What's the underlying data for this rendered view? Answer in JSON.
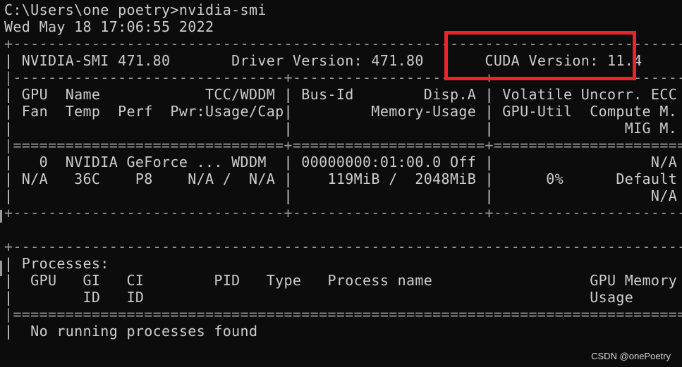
{
  "terminal": {
    "prompt_line": "C:\\Users\\one poetry>nvidia-smi",
    "timestamp_line": "Wed May 18 17:06:55 2022",
    "lines": [
      "+-----------------------------------------------------------------------------+",
      "| NVIDIA-SMI 471.80       Driver Version: 471.80       CUDA Version: 11.4     |",
      "|-------------------------------+----------------------+----------------------+",
      "| GPU  Name            TCC/WDDM | Bus-Id        Disp.A | Volatile Uncorr. ECC |",
      "| Fan  Temp  Perf  Pwr:Usage/Cap|         Memory-Usage | GPU-Util  Compute M. |",
      "|                               |                      |               MIG M. |",
      "|===============================+======================+======================|",
      "|   0  NVIDIA GeForce ... WDDM  | 00000000:01:00.0 Off |                  N/A |",
      "| N/A   36C    P8    N/A /  N/A |    119MiB /  2048MiB |      0%      Default |",
      "|                               |                      |                  N/A |",
      "+-------------------------------+----------------------+----------------------+",
      "",
      "+-----------------------------------------------------------------------------+",
      "| Processes:                                                                  |",
      "|  GPU   GI   CI        PID   Type   Process name                  GPU Memory |",
      "|        ID   ID                                                   Usage      |",
      "|=============================================================================|",
      "|  No running processes found                                                 |"
    ]
  },
  "watermark": "CSDN @onePoetry",
  "colors": {
    "background": "#0c0c0c",
    "text": "#cccccc",
    "highlight_border": "#e8262a"
  }
}
